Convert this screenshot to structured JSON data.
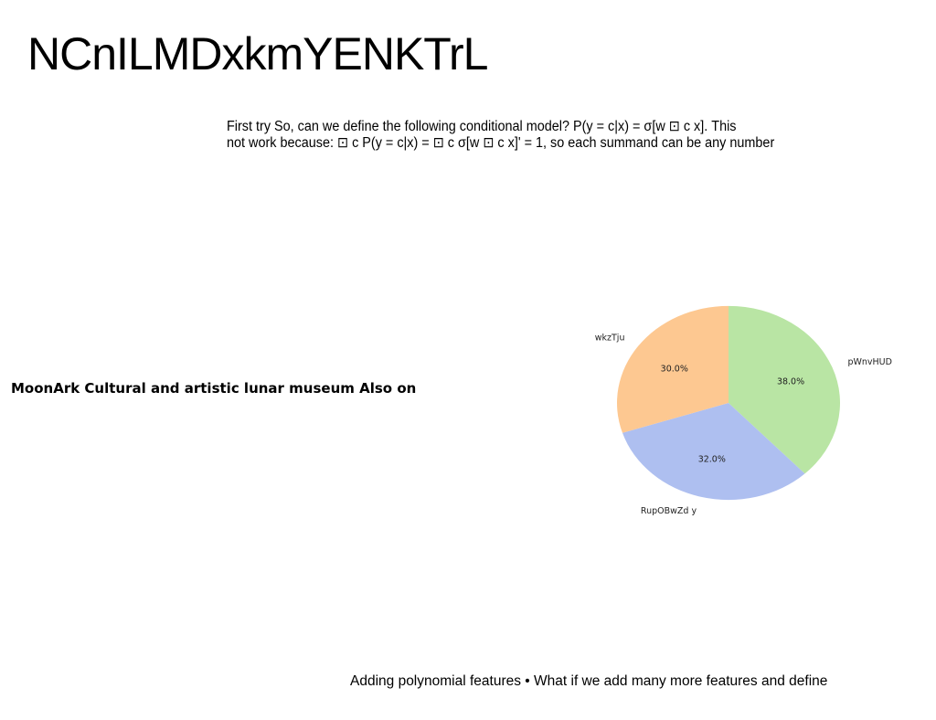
{
  "slide": {
    "title": "NCnILMDxkmYENKTrL",
    "body_lines": [
      "First try So, can we define the following conditional model? P(y = c|x) = σ[w ⊡ c x]. This",
      "not work because: ⊡ c P(y = c|x) = ⊡ c σ[w ⊡ c x]' = 1, so each summand can be any number"
    ],
    "side_caption": "MoonArk Cultural and artistic lunar museum Also on",
    "footer": "Adding polynomial features • What if we add many more features and define"
  },
  "chart_data": {
    "type": "pie",
    "title": "",
    "start_angle_deg": 90,
    "direction": "clockwise",
    "slices": [
      {
        "label": "pWnvHUD",
        "value": 38.0,
        "pct_label": "38.0%",
        "color": "#b9e5a4"
      },
      {
        "label": "RupOBwZd y",
        "value": 32.0,
        "pct_label": "32.0%",
        "color": "#aebff0"
      },
      {
        "label": "wkzTju",
        "value": 30.0,
        "pct_label": "30.0%",
        "color": "#fdc891"
      }
    ]
  }
}
